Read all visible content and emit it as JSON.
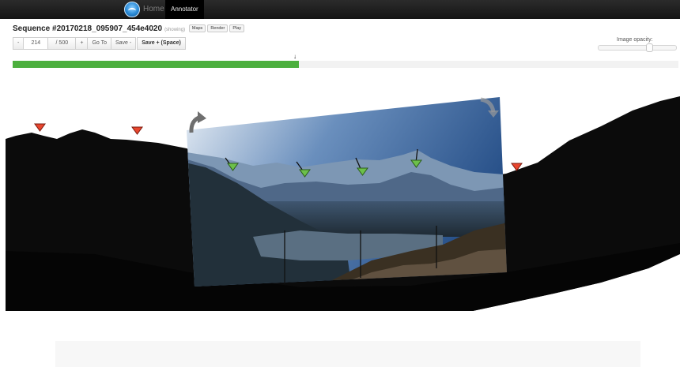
{
  "navbar": {
    "home_label": "Home",
    "annotator_label": "Annotator"
  },
  "sequence": {
    "title": "Sequence #20170218_095907_454e4020",
    "subtitle": "(showing)",
    "buttons": [
      "Maps",
      "Render",
      "Play"
    ]
  },
  "toolbar": {
    "prev_label": "-",
    "frame_value": "214",
    "frame_total": "/ 500",
    "next_label": "+",
    "goto_label": "Go To",
    "save_label": "Save -",
    "save_space_label": "Save + (Space)"
  },
  "opacity": {
    "label": "Image opacity:",
    "value": 0.65
  },
  "progress": {
    "fraction": 0.43
  },
  "colors": {
    "progress_fill": "#4caf3e",
    "peak_marker": "#e8462e",
    "annotation_marker": "#6cc04a",
    "navbar": "#1e1e1e"
  },
  "icons": {
    "rotate_left": "rotate-left-icon",
    "rotate_right": "rotate-right-icon",
    "peak_marker": "peak-marker-icon",
    "annotation_marker": "annotation-marker-icon"
  }
}
